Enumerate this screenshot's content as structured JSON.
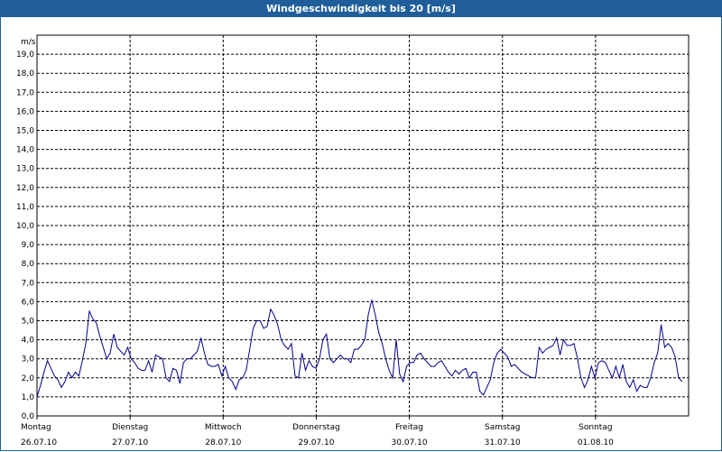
{
  "title": "Windgeschwindigkeit bis 20 [m/s]",
  "colors": {
    "titlebar": "#1f5e9a",
    "line": "#00008b",
    "grid": "#000000"
  },
  "chart_data": {
    "type": "line",
    "title": "Windgeschwindigkeit bis 20 [m/s]",
    "ylabel": "m/s",
    "ylim": [
      0,
      20
    ],
    "yticks": [
      "0,0",
      "1,0",
      "2,0",
      "3,0",
      "4,0",
      "5,0",
      "6,0",
      "7,0",
      "8,0",
      "9,0",
      "10,0",
      "11,0",
      "12,0",
      "13,0",
      "14,0",
      "15,0",
      "16,0",
      "17,0",
      "18,0",
      "19,0"
    ],
    "xlim": [
      0,
      7
    ],
    "grid": true,
    "days": [
      {
        "name": "Montag",
        "date": "26.07.10"
      },
      {
        "name": "Dienstag",
        "date": "27.07.10"
      },
      {
        "name": "Mittwoch",
        "date": "28.07.10"
      },
      {
        "name": "Donnerstag",
        "date": "29.07.10"
      },
      {
        "name": "Freitag",
        "date": "30.07.10"
      },
      {
        "name": "Samstag",
        "date": "31.07.10"
      },
      {
        "name": "Sonntag",
        "date": "01.08.10"
      }
    ],
    "series": [
      {
        "values": [
          1.0,
          1.6,
          2.3,
          2.9,
          2.5,
          2.1,
          1.9,
          1.5,
          1.8,
          2.3,
          2.0,
          2.3,
          2.1,
          2.9,
          3.8,
          5.5,
          5.1,
          4.9,
          4.2,
          3.6,
          3.0,
          3.3,
          4.3,
          3.6,
          3.4,
          3.2,
          3.6,
          3.0,
          2.8,
          2.5,
          2.4,
          2.4,
          2.9,
          2.3,
          3.2,
          3.1,
          3.0,
          2.0,
          1.8,
          2.5,
          2.4,
          1.7,
          2.8,
          3.0,
          3.0,
          3.2,
          3.4,
          4.1,
          3.3,
          2.7,
          2.6,
          2.6,
          2.7,
          2.1,
          2.6,
          2.0,
          1.8,
          1.4,
          1.9,
          2.0,
          2.4,
          3.5,
          4.6,
          5.0,
          5.0,
          4.6,
          4.7,
          5.6,
          5.3,
          4.8,
          4.0,
          3.7,
          3.5,
          3.8,
          2.1,
          2.0,
          3.3,
          2.4,
          2.9,
          2.6,
          2.5,
          3.0,
          4.0,
          4.3,
          3.0,
          2.8,
          3.0,
          3.2,
          3.0,
          3.0,
          2.8,
          3.5,
          3.5,
          3.7,
          4.0,
          5.3,
          6.1,
          5.3,
          4.4,
          3.8,
          3.0,
          2.4,
          2.0,
          4.0,
          2.2,
          1.8,
          2.6,
          2.8,
          2.8,
          3.2,
          3.3,
          3.0,
          2.8,
          2.6,
          2.6,
          2.8,
          2.9,
          2.6,
          2.3,
          2.1,
          2.4,
          2.2,
          2.4,
          2.5,
          2.0,
          2.3,
          2.3,
          1.3,
          1.1,
          1.5,
          1.9,
          2.8,
          3.3,
          3.5,
          3.3,
          3.1,
          2.6,
          2.7,
          2.5,
          2.3,
          2.2,
          2.1,
          2.0,
          2.0,
          3.6,
          3.3,
          3.5,
          3.6,
          3.7,
          4.1,
          3.2,
          4.0,
          3.7,
          3.7,
          3.8,
          3.0,
          2.0,
          1.5,
          1.9,
          2.6,
          2.0,
          2.8,
          2.9,
          2.8,
          2.4,
          2.0,
          2.6,
          2.0,
          2.7,
          1.8,
          1.5,
          1.9,
          1.3,
          1.6,
          1.5,
          1.5,
          2.0,
          2.8,
          3.3,
          4.8,
          3.6,
          3.8,
          3.6,
          3.1,
          2.0,
          1.8
        ]
      }
    ]
  }
}
